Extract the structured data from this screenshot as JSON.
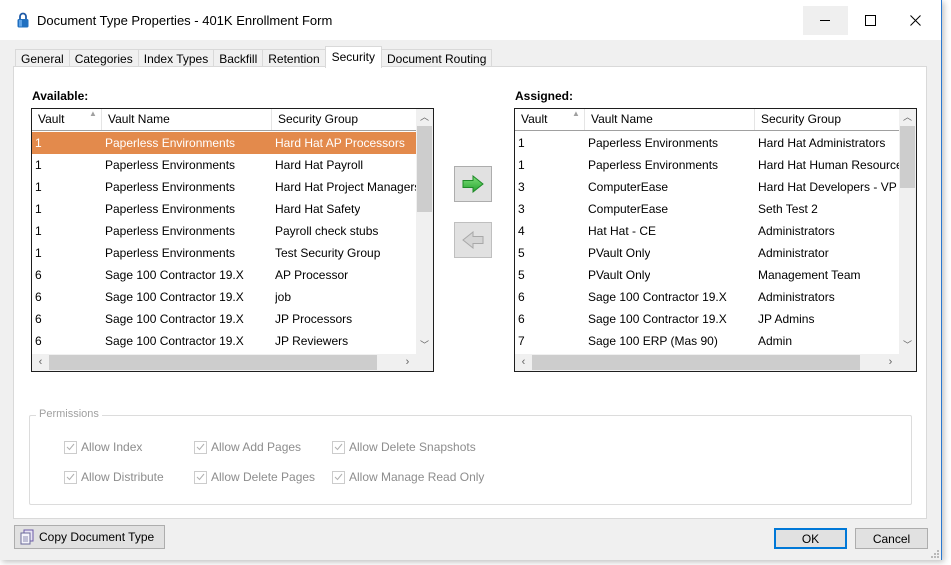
{
  "window": {
    "title": "Document Type Properties  - 401K Enrollment Form",
    "title_icon": "padlock-icon",
    "controls": {
      "minimize": "minimize-icon",
      "maximize": "maximize-icon",
      "close": "close-icon"
    }
  },
  "tabs": [
    {
      "label": "General",
      "active": false
    },
    {
      "label": "Categories",
      "active": false
    },
    {
      "label": "Index Types",
      "active": false
    },
    {
      "label": "Backfill",
      "active": false
    },
    {
      "label": "Retention",
      "active": false
    },
    {
      "label": "Security",
      "active": true
    },
    {
      "label": "Document Routing",
      "active": false
    }
  ],
  "available": {
    "label": "Available:",
    "columns": [
      "Vault",
      "Vault Name",
      "Security Group"
    ],
    "sort_column": "Vault",
    "sort_direction": "ascending",
    "rows": [
      {
        "vault": "1",
        "vault_name": "Paperless Environments",
        "security_group": "Hard Hat AP Processors",
        "selected": true
      },
      {
        "vault": "1",
        "vault_name": "Paperless Environments",
        "security_group": "Hard Hat Payroll",
        "selected": false
      },
      {
        "vault": "1",
        "vault_name": "Paperless Environments",
        "security_group": "Hard Hat Project Managers",
        "selected": false
      },
      {
        "vault": "1",
        "vault_name": "Paperless Environments",
        "security_group": "Hard Hat Safety",
        "selected": false
      },
      {
        "vault": "1",
        "vault_name": "Paperless Environments",
        "security_group": "Payroll check stubs",
        "selected": false
      },
      {
        "vault": "1",
        "vault_name": "Paperless Environments",
        "security_group": "Test Security Group",
        "selected": false
      },
      {
        "vault": "6",
        "vault_name": "Sage 100 Contractor 19.X",
        "security_group": "AP Processor",
        "selected": false
      },
      {
        "vault": "6",
        "vault_name": "Sage 100 Contractor 19.X",
        "security_group": "job",
        "selected": false
      },
      {
        "vault": "6",
        "vault_name": "Sage 100 Contractor 19.X",
        "security_group": "JP Processors",
        "selected": false
      },
      {
        "vault": "6",
        "vault_name": "Sage 100 Contractor 19.X",
        "security_group": "JP Reviewers",
        "selected": false
      }
    ]
  },
  "assigned": {
    "label": "Assigned:",
    "columns": [
      "Vault",
      "Vault Name",
      "Security Group"
    ],
    "sort_column": "Vault",
    "sort_direction": "ascending",
    "rows": [
      {
        "vault": "1",
        "vault_name": "Paperless Environments",
        "security_group": "Hard Hat Administrators"
      },
      {
        "vault": "1",
        "vault_name": "Paperless Environments",
        "security_group": "Hard Hat Human Resources"
      },
      {
        "vault": "3",
        "vault_name": "ComputerEase",
        "security_group": "Hard Hat Developers - VP Adı"
      },
      {
        "vault": "3",
        "vault_name": "ComputerEase",
        "security_group": "Seth Test 2"
      },
      {
        "vault": "4",
        "vault_name": "Hat Hat - CE",
        "security_group": "Administrators"
      },
      {
        "vault": "5",
        "vault_name": "PVault Only",
        "security_group": "Administrator"
      },
      {
        "vault": "5",
        "vault_name": "PVault Only",
        "security_group": "Management Team"
      },
      {
        "vault": "6",
        "vault_name": "Sage 100 Contractor 19.X",
        "security_group": "Administrators"
      },
      {
        "vault": "6",
        "vault_name": "Sage 100 Contractor 19.X",
        "security_group": "JP Admins"
      },
      {
        "vault": "7",
        "vault_name": "Sage 100 ERP (Mas 90)",
        "security_group": "Admin"
      }
    ]
  },
  "move_buttons": {
    "assign": {
      "icon": "arrow-right-icon",
      "enabled": true,
      "color": "#3cb54a"
    },
    "unassign": {
      "icon": "arrow-left-icon",
      "enabled": false,
      "color": "#c8c8c8"
    }
  },
  "permissions": {
    "title": "Permissions",
    "enabled": false,
    "items": [
      {
        "label": "Allow Index",
        "checked": true
      },
      {
        "label": "Allow Add Pages",
        "checked": true
      },
      {
        "label": "Allow Delete Snapshots",
        "checked": true
      },
      {
        "label": "Allow Distribute",
        "checked": true
      },
      {
        "label": "Allow Delete Pages",
        "checked": true
      },
      {
        "label": "Allow Manage Read Only",
        "checked": true
      }
    ]
  },
  "footer": {
    "copy_label": "Copy Document Type",
    "ok_label": "OK",
    "cancel_label": "Cancel"
  },
  "colors": {
    "selection": "#e38a4c",
    "accent": "#0078d7"
  }
}
